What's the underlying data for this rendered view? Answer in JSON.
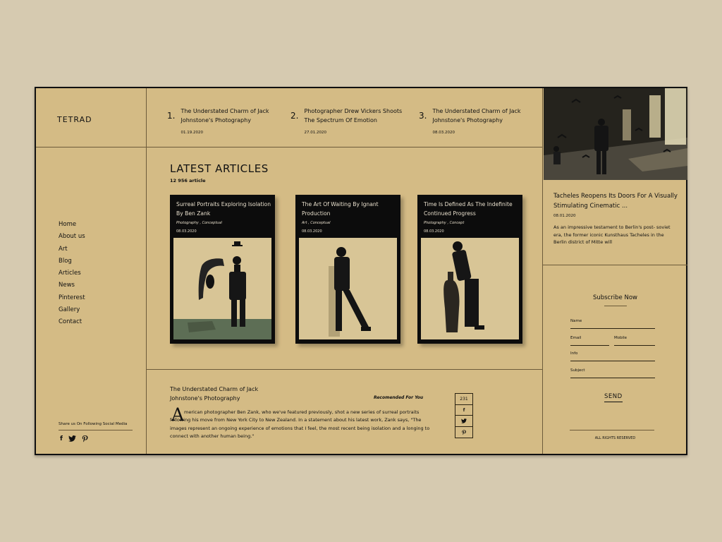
{
  "brand": "TETRAD",
  "nav": [
    "Home",
    "About us",
    "Art",
    "Blog",
    "Articles",
    "News",
    "Pinterest",
    "Gallery",
    "Contact"
  ],
  "share_text": "Share us On Following Social Media",
  "social_icons": [
    "facebook-icon",
    "twitter-icon",
    "pinterest-icon"
  ],
  "social_glyphs": [
    "f",
    "🐦",
    "℗"
  ],
  "top_articles": [
    {
      "num": "1.",
      "title_1": "The Understated Charm of Jack",
      "title_2": "Johnstone's Photography",
      "date": "01.19.2020"
    },
    {
      "num": "2.",
      "title_1": "Photographer Drew Vickers Shoots",
      "title_2": "The Spectrum Of Emotion",
      "date": "27.01.2020"
    },
    {
      "num": "3.",
      "title_1": "The Understated Charm of Jack",
      "title_2": "Johnstone's Photography",
      "date": "08.03.2020"
    }
  ],
  "latest": {
    "heading": "LATEST ARTICLES",
    "count": "12 956 article"
  },
  "cards": [
    {
      "title": "Surreal Portraits Exploring Isolation By Ben Zank",
      "meta": "Photography , Conceptual",
      "date": "08.03.2020"
    },
    {
      "title": "The Art Of Waiting By Ignant Production",
      "meta": "Art , Conceptual",
      "date": "08.03.2020"
    },
    {
      "title": "Time Is Defined As The Indefinite Continued Progress",
      "meta": "Photography , Concept",
      "date": "08.03.2020"
    }
  ],
  "article": {
    "title_1": "The Understated Charm of Jack",
    "title_2": "Johnstone's Photography",
    "recommended": "Recomended For You",
    "dropcap": "A",
    "body": "merican photographer Ben Zank, who we've featured previously, shot a new series of surreal portraits following his move from New York City to New Zealand. In a statement about his latest work, Zank says, \"The images represent an ongoing experience of emotions that I feel, the most recent being isolation and a longing to connect with another human being.\""
  },
  "share_counter": {
    "count": "231",
    "icons": [
      "f",
      "🐦",
      "℗"
    ]
  },
  "feature": {
    "title": "Tacheles Reopens Its Doors For A Visually Stimulating Cinematic ...",
    "date": "08.01.2020",
    "text": "As an impressive testament to Berlin's post- soviet era, the former iconic Kunsthaus Tacheles in the Berlin district of Mitte will"
  },
  "subscribe": {
    "title": "Subscribe Now",
    "fields": {
      "name": "Name",
      "email": "Email",
      "mobile": "Mobile",
      "info": "Info",
      "subject": "Subject"
    },
    "send": "SEND"
  },
  "rights": "ALL RIGHTS RESERVED"
}
